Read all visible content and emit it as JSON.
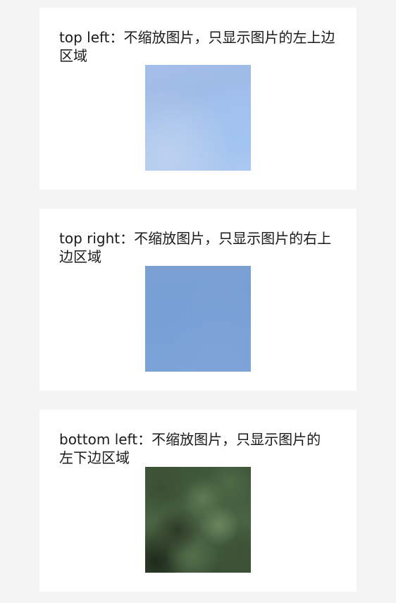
{
  "cards": [
    {
      "label": "top left：不缩放图片，只显示图片的左上边区域",
      "image": "sky-image-top-left",
      "mode": "top left"
    },
    {
      "label": "top right：不缩放图片，只显示图片的右上边区域",
      "image": "sky-image-top-right",
      "mode": "top right"
    },
    {
      "label": "bottom left：不缩放图片，只显示图片的左下边区域",
      "image": "foliage-image-bottom-left",
      "mode": "bottom left"
    }
  ],
  "colors": {
    "page_background": "#f4f4f4",
    "card_background": "#ffffff",
    "text": "#1a1a1a"
  }
}
